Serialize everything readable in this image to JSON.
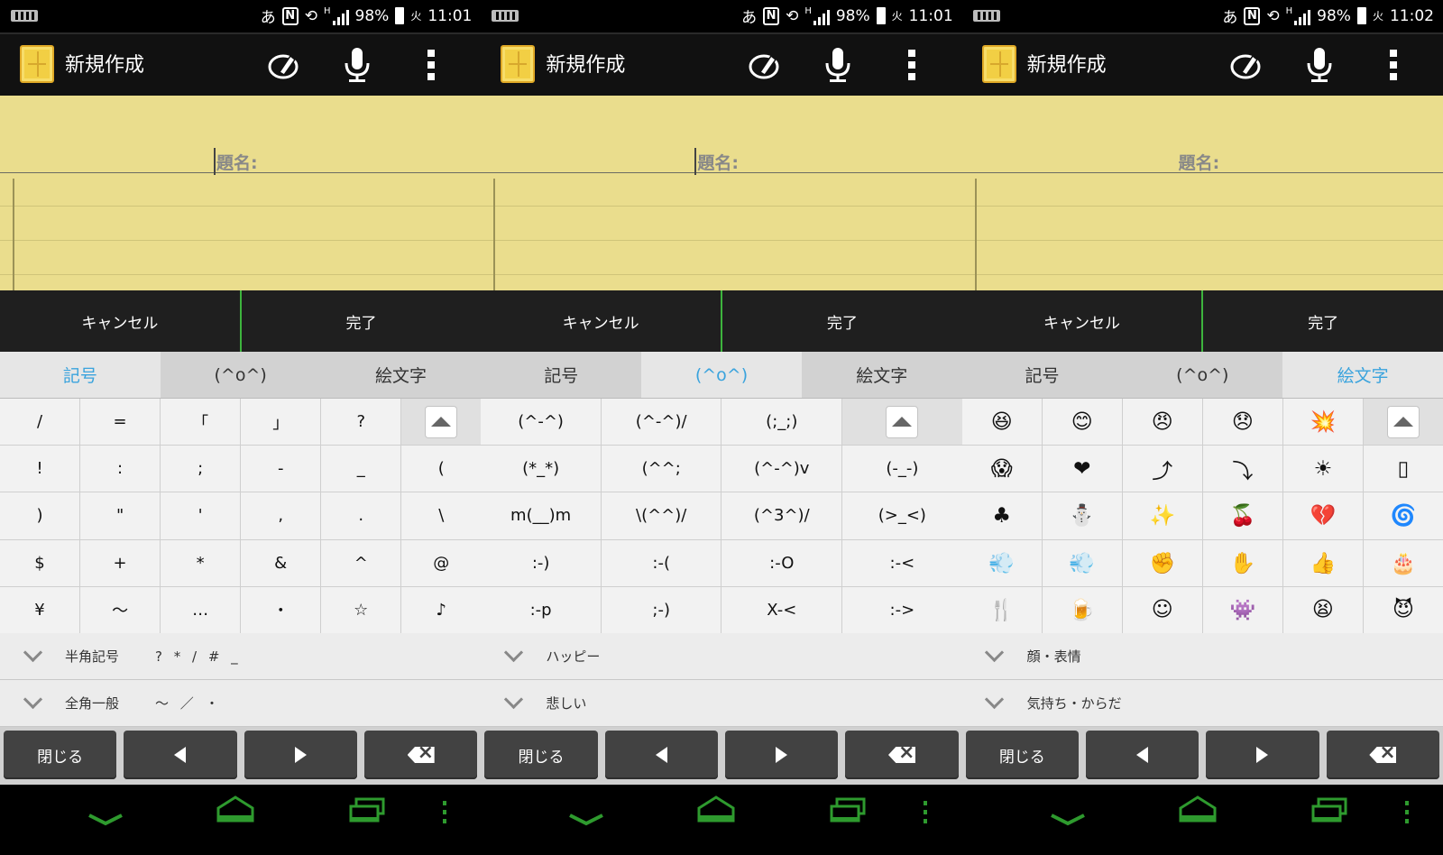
{
  "colors": {
    "note_paper": "#eadd8d",
    "accent_active_tab": "#3aa3dd",
    "done_separator": "#3db43d",
    "nav_green": "#2e9a2e",
    "key_dark": "#424242"
  },
  "panels": [
    {
      "status": {
        "ime": "あ",
        "nfc": "N",
        "network": "H",
        "battery": "98%",
        "day": "火",
        "time": "11:01"
      },
      "app": {
        "title": "新規作成",
        "icons": [
          "memo-icon",
          "handwriting-icon",
          "microphone-icon",
          "overflow-menu-icon"
        ]
      },
      "note": {
        "title_label": "題名:"
      },
      "buttons": {
        "cancel": "キャンセル",
        "done": "完了"
      },
      "tabs": [
        {
          "label": "記号",
          "active": true
        },
        {
          "label": "(^o^)",
          "active": false
        },
        {
          "label": "絵文字",
          "active": false
        }
      ],
      "grid_type": "g6",
      "keys": [
        "/",
        "=",
        "「",
        "」",
        "?",
        "",
        "!",
        ":",
        ";",
        "-",
        "_",
        "(",
        ")",
        "\"",
        "'",
        ",",
        ".",
        "\\",
        "$",
        "+",
        "*",
        "&",
        "^",
        "@",
        "¥",
        "〜",
        "…",
        "・",
        "☆",
        "♪"
      ],
      "categories": [
        {
          "name": "半角記号",
          "sample": "? * / # _"
        },
        {
          "name": "全角一般",
          "sample": "〜 ／ ・"
        }
      ],
      "controls": {
        "close": "閉じる"
      }
    },
    {
      "status": {
        "ime": "あ",
        "nfc": "N",
        "network": "H",
        "battery": "98%",
        "day": "火",
        "time": "11:01"
      },
      "app": {
        "title": "新規作成",
        "icons": [
          "memo-icon",
          "handwriting-icon",
          "microphone-icon",
          "overflow-menu-icon"
        ]
      },
      "note": {
        "title_label": "題名:"
      },
      "buttons": {
        "cancel": "キャンセル",
        "done": "完了"
      },
      "tabs": [
        {
          "label": "記号",
          "active": false
        },
        {
          "label": "(^o^)",
          "active": true
        },
        {
          "label": "絵文字",
          "active": false
        }
      ],
      "grid_type": "g4",
      "keys": [
        "(^-^)",
        "(^-^)/",
        "(;_;)",
        "",
        "(*_*)",
        "(^^;",
        "(^-^)v",
        "(-_-)",
        "m(__)m",
        "\\(^^)/",
        "(^3^)/",
        "(>_<)",
        ":-)",
        ":-(",
        ":-O",
        ":-<",
        ":-p",
        ";-)",
        "X-<",
        ":->"
      ],
      "categories": [
        {
          "name": "ハッピー",
          "sample": ""
        },
        {
          "name": "悲しい",
          "sample": ""
        }
      ],
      "controls": {
        "close": "閉じる"
      }
    },
    {
      "status": {
        "ime": "あ",
        "nfc": "N",
        "network": "H",
        "battery": "98%",
        "day": "火",
        "time": "11:02"
      },
      "app": {
        "title": "新規作成",
        "icons": [
          "memo-icon",
          "handwriting-icon",
          "microphone-icon",
          "overflow-menu-icon"
        ]
      },
      "note": {
        "title_label": "題名:"
      },
      "buttons": {
        "cancel": "キャンセル",
        "done": "完了"
      },
      "tabs": [
        {
          "label": "記号",
          "active": false
        },
        {
          "label": "(^o^)",
          "active": false
        },
        {
          "label": "絵文字",
          "active": true
        }
      ],
      "grid_type": "g6",
      "keys": [
        "😆",
        "😊",
        "😠",
        "😞",
        "💥",
        "",
        "😱",
        "❤",
        "⤴",
        "⤵",
        "☀",
        "▯",
        "♣",
        "⛄",
        "✨",
        "🍒",
        "💔",
        "🌀",
        "💨",
        "💨",
        "✊",
        "✋",
        "👍",
        "🎂",
        "🍴",
        "🍺",
        "☺",
        "👾",
        "😫",
        "😈"
      ],
      "categories": [
        {
          "name": "顔・表情",
          "sample": ""
        },
        {
          "name": "気持ち・からだ",
          "sample": ""
        }
      ],
      "controls": {
        "close": "閉じる"
      }
    }
  ]
}
